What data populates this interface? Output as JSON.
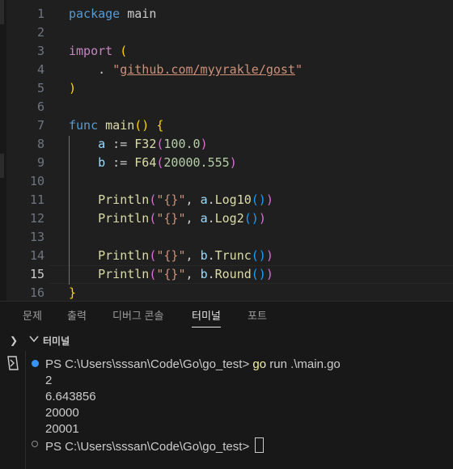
{
  "editor": {
    "current_line": 15,
    "lines": [
      {
        "n": "1",
        "tokens": [
          [
            "kw",
            "package"
          ],
          [
            "txt",
            " main"
          ]
        ]
      },
      {
        "n": "2",
        "tokens": []
      },
      {
        "n": "3",
        "tokens": [
          [
            "kw2",
            "import"
          ],
          [
            "txt",
            " "
          ],
          [
            "br1",
            "("
          ]
        ]
      },
      {
        "n": "4",
        "tokens": [
          [
            "txt",
            "    . "
          ],
          [
            "str",
            "\""
          ],
          [
            "str-u",
            "github.com/myyrakle/gost"
          ],
          [
            "str",
            "\""
          ]
        ]
      },
      {
        "n": "5",
        "tokens": [
          [
            "br1",
            ")"
          ]
        ]
      },
      {
        "n": "6",
        "tokens": []
      },
      {
        "n": "7",
        "tokens": [
          [
            "kw",
            "func"
          ],
          [
            "txt",
            " "
          ],
          [
            "fn",
            "main"
          ],
          [
            "br1",
            "()"
          ],
          [
            "txt",
            " "
          ],
          [
            "br1",
            "{"
          ]
        ]
      },
      {
        "n": "8",
        "tokens": [
          [
            "txt",
            "    "
          ],
          [
            "var",
            "a"
          ],
          [
            "txt",
            " := "
          ],
          [
            "fn",
            "F32"
          ],
          [
            "br2",
            "("
          ],
          [
            "num-lit",
            "100.0"
          ],
          [
            "br2",
            ")"
          ]
        ]
      },
      {
        "n": "9",
        "tokens": [
          [
            "txt",
            "    "
          ],
          [
            "var",
            "b"
          ],
          [
            "txt",
            " := "
          ],
          [
            "fn",
            "F64"
          ],
          [
            "br2",
            "("
          ],
          [
            "num-lit",
            "20000.555"
          ],
          [
            "br2",
            ")"
          ]
        ]
      },
      {
        "n": "10",
        "tokens": []
      },
      {
        "n": "11",
        "tokens": [
          [
            "txt",
            "    "
          ],
          [
            "fn",
            "Println"
          ],
          [
            "br2",
            "("
          ],
          [
            "str",
            "\"{}\""
          ],
          [
            "txt",
            ", "
          ],
          [
            "var",
            "a"
          ],
          [
            "txt",
            "."
          ],
          [
            "fn",
            "Log10"
          ],
          [
            "br3",
            "()"
          ],
          [
            "br2",
            ")"
          ]
        ]
      },
      {
        "n": "12",
        "tokens": [
          [
            "txt",
            "    "
          ],
          [
            "fn",
            "Println"
          ],
          [
            "br2",
            "("
          ],
          [
            "str",
            "\"{}\""
          ],
          [
            "txt",
            ", "
          ],
          [
            "var",
            "a"
          ],
          [
            "txt",
            "."
          ],
          [
            "fn",
            "Log2"
          ],
          [
            "br3",
            "()"
          ],
          [
            "br2",
            ")"
          ]
        ]
      },
      {
        "n": "13",
        "tokens": []
      },
      {
        "n": "14",
        "tokens": [
          [
            "txt",
            "    "
          ],
          [
            "fn",
            "Println"
          ],
          [
            "br2",
            "("
          ],
          [
            "str",
            "\"{}\""
          ],
          [
            "txt",
            ", "
          ],
          [
            "var",
            "b"
          ],
          [
            "txt",
            "."
          ],
          [
            "fn",
            "Trunc"
          ],
          [
            "br3",
            "()"
          ],
          [
            "br2",
            ")"
          ]
        ]
      },
      {
        "n": "15",
        "tokens": [
          [
            "txt",
            "    "
          ],
          [
            "fn",
            "Println"
          ],
          [
            "br2",
            "("
          ],
          [
            "str",
            "\"{}\""
          ],
          [
            "txt",
            ", "
          ],
          [
            "var",
            "b"
          ],
          [
            "txt",
            "."
          ],
          [
            "fn",
            "Round"
          ],
          [
            "br3",
            "()"
          ],
          [
            "br2",
            ")"
          ]
        ]
      },
      {
        "n": "16",
        "tokens": [
          [
            "br1",
            "}"
          ]
        ]
      }
    ]
  },
  "panel": {
    "tabs": [
      "문제",
      "출력",
      "디버그 콘솔",
      "터미널",
      "포트"
    ],
    "active_tab": "터미널",
    "terminal_title": "터미널"
  },
  "terminal": {
    "prompt": "PS C:\\Users\\sssan\\Code\\Go\\go_test> ",
    "command_go": "go",
    "command_rest": " run .\\main.go",
    "output": [
      "2",
      "6.643856",
      "20000",
      "20001"
    ]
  },
  "colors": {
    "background": "#1f1f1f",
    "accent": "#3794ff"
  }
}
